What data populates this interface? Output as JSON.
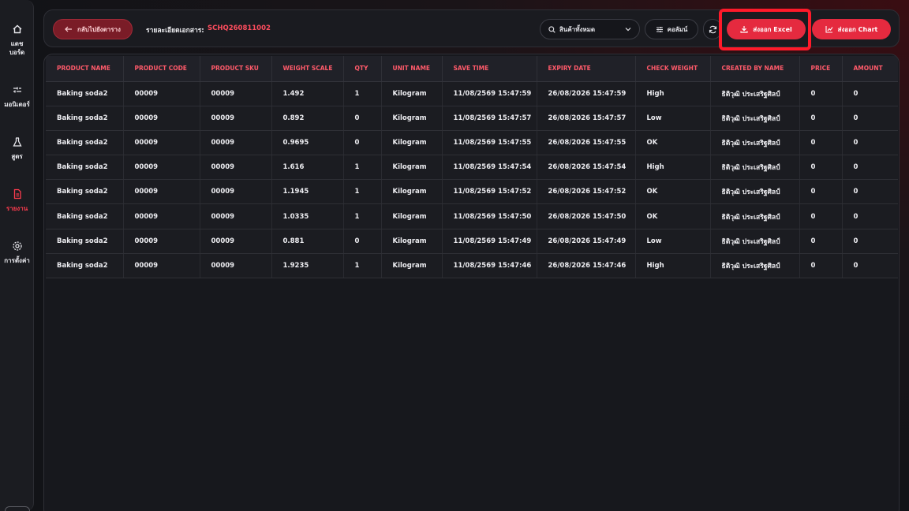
{
  "sidebar": {
    "items": [
      {
        "label_line1": "แดช",
        "label_line2": "บอร์ด",
        "icon": "home-icon"
      },
      {
        "label_line1": "มอนิเตอร์",
        "label_line2": "",
        "icon": "monitor-icon"
      },
      {
        "label_line1": "สูตร",
        "label_line2": "",
        "icon": "flask-icon"
      },
      {
        "label_line1": "รายงาน",
        "label_line2": "",
        "icon": "report-icon",
        "active": true
      },
      {
        "label_line1": "การตั้งค่า",
        "label_line2": "",
        "icon": "gear-icon"
      }
    ]
  },
  "header": {
    "back_label": "กลับไปยังตาราง",
    "doc_label": "รายละเอียดเอกสาร:",
    "doc_code": "SCHQ260811002",
    "product_filter": "สินค้าทั้งหมด",
    "columns_label": "คอลัมน์",
    "export_excel_label": "ส่งออก Excel",
    "export_chart_label": "ส่งออก Chart"
  },
  "colors": {
    "accent": "#e52a3f",
    "header_text": "#ff5a6a",
    "highlight": "#ff1a2a"
  },
  "table": {
    "columns": [
      "PRODUCT NAME",
      "PRODUCT CODE",
      "PRODUCT SKU",
      "WEIGHT SCALE",
      "QTY",
      "UNIT NAME",
      "SAVE TIME",
      "EXPIRY DATE",
      "CHECK WEIGHT",
      "CREATED BY NAME",
      "PRICE",
      "AMOUNT"
    ],
    "rows": [
      [
        "Baking soda2",
        "00009",
        "00009",
        "1.492",
        "1",
        "Kilogram",
        "11/08/2569 15:47:59",
        "26/08/2026 15:47:59",
        "High",
        "ธิติวุฒิ ประเสริฐศิลป์",
        "0",
        "0"
      ],
      [
        "Baking soda2",
        "00009",
        "00009",
        "0.892",
        "0",
        "Kilogram",
        "11/08/2569 15:47:57",
        "26/08/2026 15:47:57",
        "Low",
        "ธิติวุฒิ ประเสริฐศิลป์",
        "0",
        "0"
      ],
      [
        "Baking soda2",
        "00009",
        "00009",
        "0.9695",
        "0",
        "Kilogram",
        "11/08/2569 15:47:55",
        "26/08/2026 15:47:55",
        "OK",
        "ธิติวุฒิ ประเสริฐศิลป์",
        "0",
        "0"
      ],
      [
        "Baking soda2",
        "00009",
        "00009",
        "1.616",
        "1",
        "Kilogram",
        "11/08/2569 15:47:54",
        "26/08/2026 15:47:54",
        "High",
        "ธิติวุฒิ ประเสริฐศิลป์",
        "0",
        "0"
      ],
      [
        "Baking soda2",
        "00009",
        "00009",
        "1.1945",
        "1",
        "Kilogram",
        "11/08/2569 15:47:52",
        "26/08/2026 15:47:52",
        "OK",
        "ธิติวุฒิ ประเสริฐศิลป์",
        "0",
        "0"
      ],
      [
        "Baking soda2",
        "00009",
        "00009",
        "1.0335",
        "1",
        "Kilogram",
        "11/08/2569 15:47:50",
        "26/08/2026 15:47:50",
        "OK",
        "ธิติวุฒิ ประเสริฐศิลป์",
        "0",
        "0"
      ],
      [
        "Baking soda2",
        "00009",
        "00009",
        "0.881",
        "0",
        "Kilogram",
        "11/08/2569 15:47:49",
        "26/08/2026 15:47:49",
        "Low",
        "ธิติวุฒิ ประเสริฐศิลป์",
        "0",
        "0"
      ],
      [
        "Baking soda2",
        "00009",
        "00009",
        "1.9235",
        "1",
        "Kilogram",
        "11/08/2569 15:47:46",
        "26/08/2026 15:47:46",
        "High",
        "ธิติวุฒิ ประเสริฐศิลป์",
        "0",
        "0"
      ]
    ]
  }
}
